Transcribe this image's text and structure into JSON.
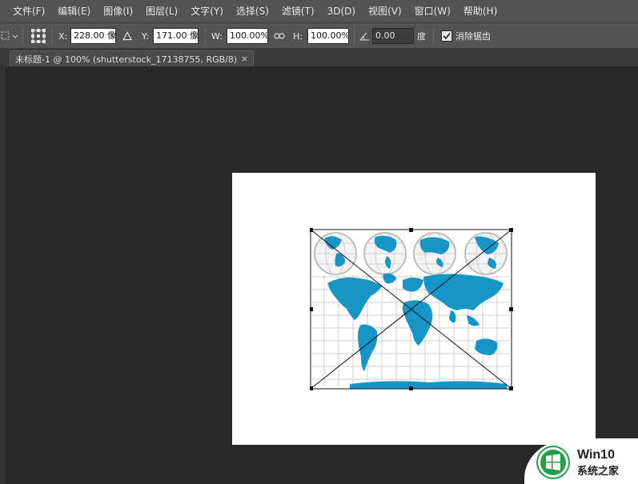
{
  "menu": [
    "文件(F)",
    "编辑(E)",
    "图像(I)",
    "图层(L)",
    "文字(Y)",
    "选择(S)",
    "滤镜(T)",
    "3D(D)",
    "视图(V)",
    "窗口(W)",
    "帮助(H)"
  ],
  "options": {
    "x_label": "X:",
    "x_value": "228.00 像⁙",
    "y_label": "Y:",
    "y_value": "171.00 像⁙",
    "w_label": "W:",
    "w_value": "100.00%",
    "h_label": "H:",
    "h_value": "100.00%",
    "angle_value": "0.00",
    "angle_unit": "度",
    "antialias_label": "消除锯齿",
    "antialias_checked": true
  },
  "document_tab": {
    "title": "未标题-1 @ 100% (shutterstock_17138755, RGB/8)",
    "close": "×"
  },
  "colors": {
    "map_blue": "#1596c6",
    "globe_grey": "#c8c8c8",
    "panel": "#535353",
    "workspace": "#282828",
    "watermark_green": "#23a047"
  },
  "icons": [
    "marquee-icon",
    "reference-point-icon",
    "triangle-delta-icon",
    "link-icon",
    "rotate-angle-icon",
    "checkbox-icon",
    "windows-logo-icon"
  ],
  "watermark": {
    "brand": "Win10",
    "subtitle": "系统之家"
  }
}
